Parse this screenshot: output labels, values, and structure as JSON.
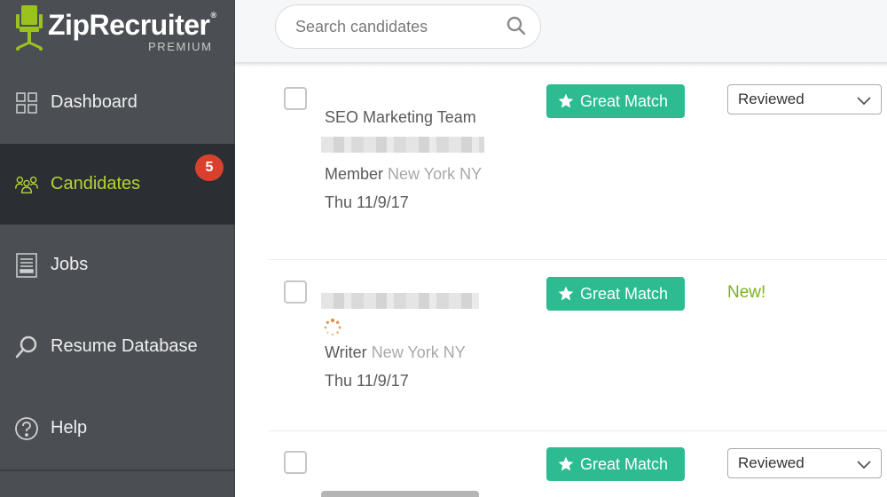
{
  "brand": {
    "name": "ZipRecruiter",
    "registered": "®",
    "tier": "PREMIUM",
    "accent_color": "#9ac31c"
  },
  "sidebar": {
    "items": [
      {
        "label": "Dashboard",
        "icon": "grid-icon",
        "active": false
      },
      {
        "label": "Candidates",
        "icon": "people-icon",
        "active": true,
        "badge": "5"
      },
      {
        "label": "Jobs",
        "icon": "document-icon",
        "active": false
      },
      {
        "label": "Resume Database",
        "icon": "search-icon",
        "active": false
      },
      {
        "label": "Help",
        "icon": "help-circle-icon",
        "active": false
      }
    ],
    "active_color": "#b5d334",
    "badge_color": "#d9412f"
  },
  "search": {
    "placeholder": "Search candidates",
    "value": ""
  },
  "candidates": [
    {
      "title": "SEO Marketing Team",
      "name_blurred": true,
      "role": "Member",
      "location": "New York NY",
      "date": "Thu 11/9/17",
      "match_label": "Great Match",
      "status": "Reviewed"
    },
    {
      "title": "",
      "name_blurred": true,
      "loading": true,
      "role": "Writer",
      "location": "New York NY",
      "date": "Thu 11/9/17",
      "match_label": "Great Match",
      "status_label": "New!"
    },
    {
      "title": "",
      "match_label": "Great Match",
      "status": "Reviewed"
    }
  ],
  "colors": {
    "match_button": "#2dbb92",
    "new_label": "#7ab317"
  }
}
